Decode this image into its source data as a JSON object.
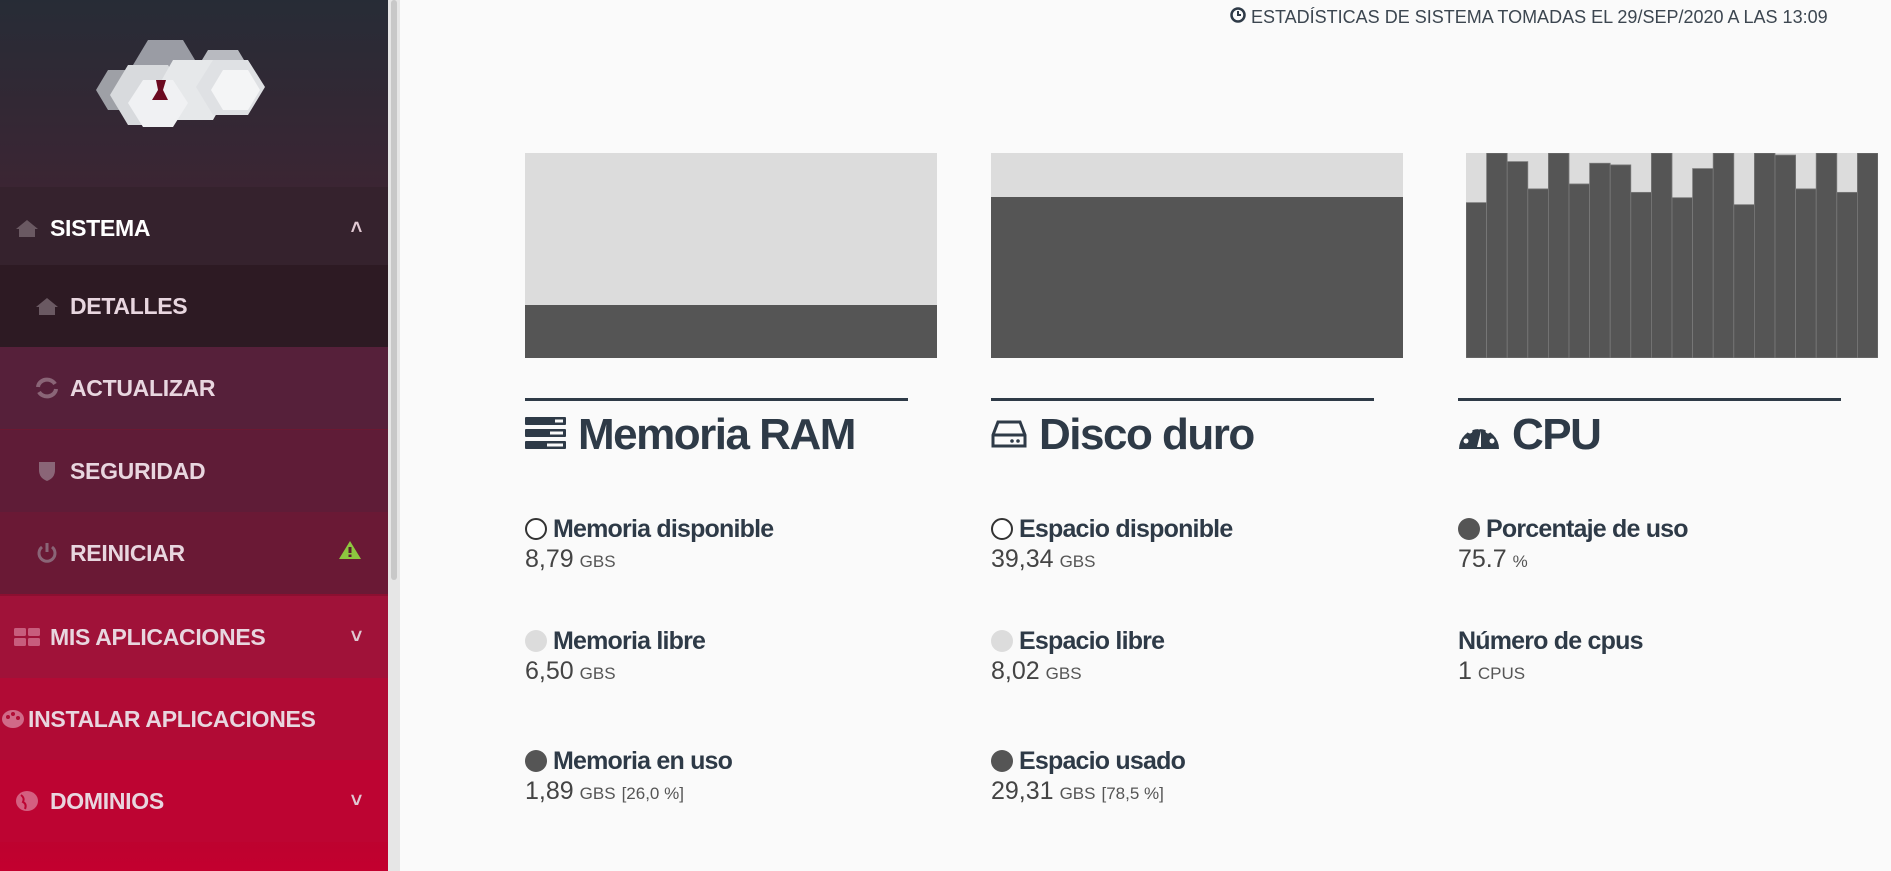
{
  "sidebar": {
    "items": [
      {
        "label": "SISTEMA",
        "icon": "home-icon",
        "expanded": true
      },
      {
        "label": "DETALLES",
        "icon": "home-icon",
        "active": true
      },
      {
        "label": "ACTUALIZAR",
        "icon": "refresh-icon"
      },
      {
        "label": "SEGURIDAD",
        "icon": "shield-icon"
      },
      {
        "label": "REINICIAR",
        "icon": "power-icon",
        "badge": "warning-icon"
      },
      {
        "label": "MIS APLICACIONES",
        "icon": "grid-icon"
      },
      {
        "label": "INSTALAR APLICACIONES",
        "icon": "palette-icon"
      },
      {
        "label": "DOMINIOS",
        "icon": "globe-icon"
      }
    ],
    "chevron_up": "˄",
    "chevron_down": "˅"
  },
  "header": {
    "timestamp": "ESTADÍSTICAS DE SISTEMA TOMADAS EL 29/SEP/2020 A LAS 13:09"
  },
  "colors": {
    "used": "#555555",
    "free": "#dcdcdc",
    "text": "#2e3a47",
    "warning": "#8dc63f"
  },
  "ram": {
    "title": "Memoria RAM",
    "used_fraction": 0.26,
    "stats": [
      {
        "label": "Memoria disponible",
        "value": "8,79",
        "unit": "GBS",
        "extra": ""
      },
      {
        "label": "Memoria libre",
        "value": "6,50",
        "unit": "GBS",
        "extra": ""
      },
      {
        "label": "Memoria en uso",
        "value": "1,89",
        "unit": "GBS",
        "extra": "[26,0 %]"
      }
    ]
  },
  "disk": {
    "title": "Disco duro",
    "used_fraction": 0.785,
    "stats": [
      {
        "label": "Espacio disponible",
        "value": "39,34",
        "unit": "GBS",
        "extra": ""
      },
      {
        "label": "Espacio libre",
        "value": "8,02",
        "unit": "GBS",
        "extra": ""
      },
      {
        "label": "Espacio usado",
        "value": "29,31",
        "unit": "GBS",
        "extra": "[78,5 %]"
      }
    ]
  },
  "cpu": {
    "title": "CPU",
    "stats": [
      {
        "label": "Porcentaje de uso",
        "value": "75.7",
        "unit": "%"
      },
      {
        "label": "Número de cpus",
        "value": "1",
        "unit": "CPUS"
      }
    ]
  },
  "chart_data": {
    "type": "bar",
    "title": "",
    "ylim": [
      0,
      100
    ],
    "values": [
      75.8,
      100,
      95.8,
      82.5,
      100,
      84.9,
      95,
      94.2,
      80.8,
      100,
      78.2,
      92.4,
      100,
      74.8,
      100,
      99,
      82.5,
      100,
      80.8,
      100
    ]
  }
}
